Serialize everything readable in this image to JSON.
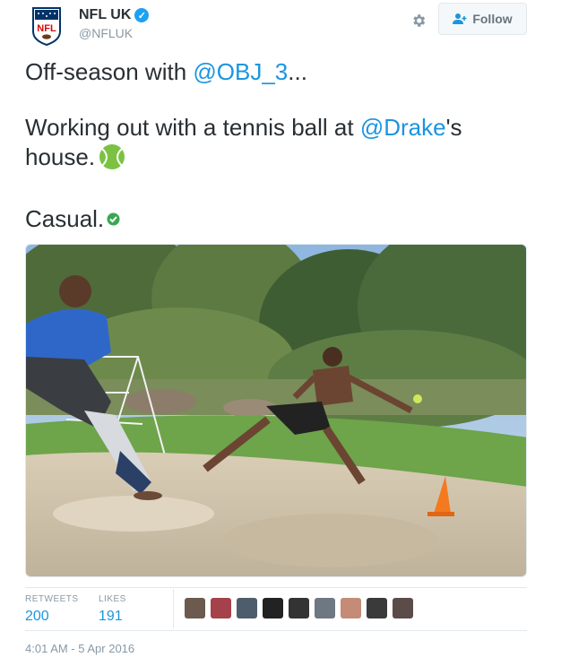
{
  "account": {
    "display_name": "NFL UK",
    "handle": "@NFLUK",
    "logo_text": "NFL",
    "verified_icon": "verified-badge-icon"
  },
  "actions": {
    "follow_label": "Follow",
    "settings_icon": "gear-icon"
  },
  "tweet": {
    "line1_prefix": "Off-season with ",
    "line1_mention": "@OBJ_3",
    "line1_suffix": "...",
    "line2_prefix": "Working out with a tennis ball at ",
    "line2_mention": "@Drake",
    "line2_suffix": "'s house.",
    "line3": "Casual."
  },
  "stats": {
    "retweets_label": "RETWEETS",
    "retweets_value": "200",
    "likes_label": "LIKES",
    "likes_value": "191"
  },
  "likers_count_shown": 9,
  "timestamp": "4:01 AM - 5 Apr 2016",
  "colors": {
    "accent": "#1b95e0",
    "muted": "#8899a6",
    "nfl_blue": "#013369",
    "nfl_red": "#d50a0a",
    "tennis_green": "#7cc242"
  }
}
